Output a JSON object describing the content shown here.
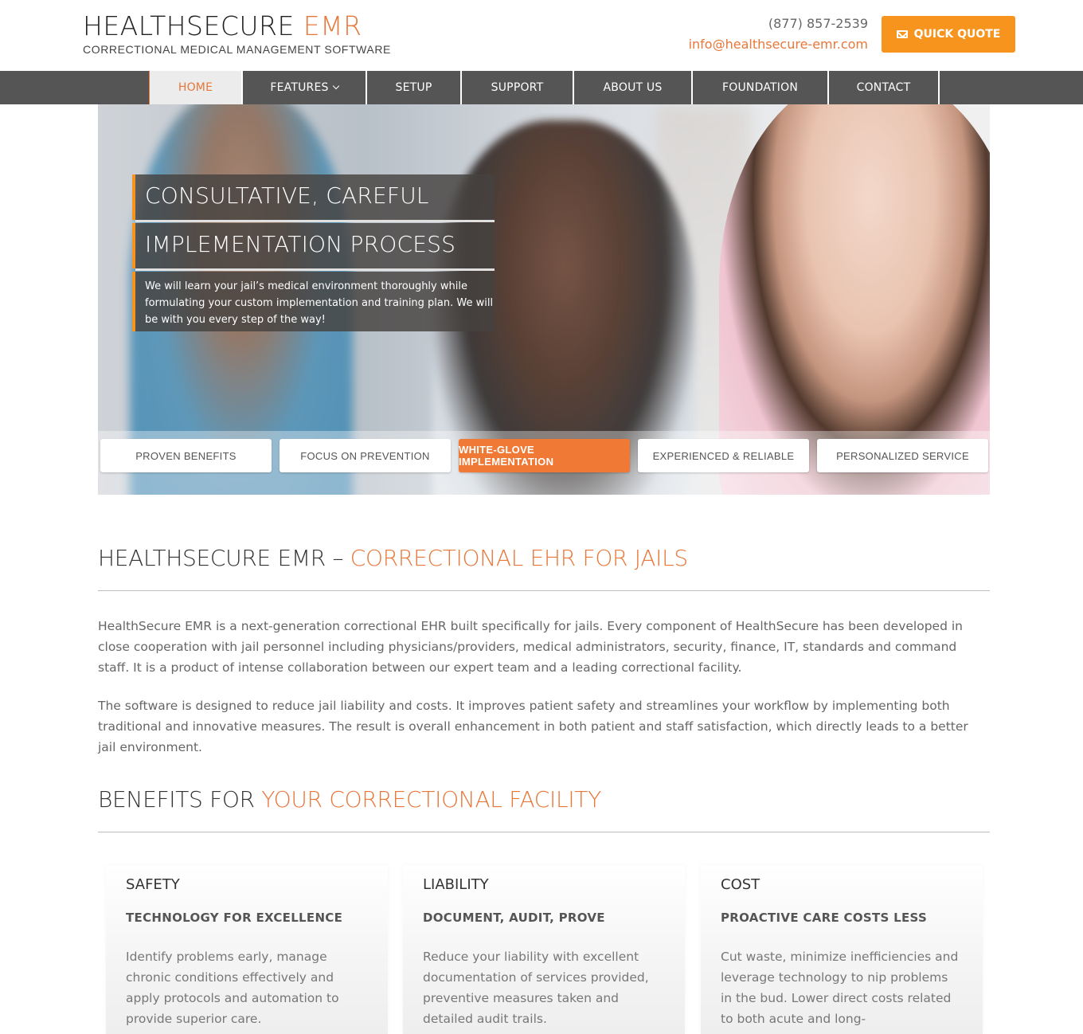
{
  "header": {
    "logo_main": "HEALTHSECURE",
    "logo_accent": "EMR",
    "logo_sub": "CORRECTIONAL MEDICAL MANAGEMENT SOFTWARE",
    "phone": "(877) 857-2539",
    "email": "info@healthsecure-emr.com",
    "quote_label": "QUICK QUOTE",
    "quote_icon": "envelope-icon"
  },
  "nav": {
    "items": [
      {
        "label": "HOME",
        "active": true
      },
      {
        "label": "FEATURES",
        "has_dropdown": true
      },
      {
        "label": "SETUP"
      },
      {
        "label": "SUPPORT"
      },
      {
        "label": "ABOUT US"
      },
      {
        "label": "FOUNDATION"
      },
      {
        "label": "CONTACT"
      }
    ]
  },
  "hero": {
    "caption_line1": "CONSULTATIVE, CAREFUL",
    "caption_line2": "IMPLEMENTATION PROCESS",
    "caption_body": "We will learn your jail’s medical environment thoroughly while formulating your custom implementation and training plan. We will be with you every step of the way!",
    "tabs": [
      {
        "label": "PROVEN BENEFITS"
      },
      {
        "label": "FOCUS ON PREVENTION"
      },
      {
        "label": "WHITE-GLOVE IMPLEMENTATION",
        "active": true
      },
      {
        "label": "EXPERIENCED & RELIABLE"
      },
      {
        "label": "PERSONALIZED SERVICE"
      }
    ]
  },
  "intro": {
    "title_plain": "HEALTHSECURE EMR – ",
    "title_accent": "CORRECTIONAL EHR FOR JAILS",
    "para1": "HealthSecure EMR is a next-generation correctional EHR built specifically for jails. Every component of HealthSecure has been developed in close cooperation with jail personnel including physicians/providers, medical administrators, security, finance, IT, standards and command staff. It is a product of intense collaboration between our expert team and a leading correctional facility.",
    "para2": "The software is designed to reduce jail liability and costs. It improves patient safety and streamlines your workflow by implementing both traditional and innovative measures. The result is overall enhancement in both patient and staff satisfaction, which directly leads to a better jail environment."
  },
  "benefits": {
    "title_plain": "BENEFITS FOR ",
    "title_accent": "YOUR CORRECTIONAL FACILITY",
    "cards": [
      {
        "title": "SAFETY",
        "subtitle": "TECHNOLOGY FOR EXCELLENCE",
        "body": "Identify problems early, manage chronic conditions effectively and apply protocols and automation to provide superior care."
      },
      {
        "title": "LIABILITY",
        "subtitle": "DOCUMENT, AUDIT, PROVE",
        "body": "Reduce your liability with excellent documentation of services provided, preventive measures taken and detailed audit trails."
      },
      {
        "title": "COST",
        "subtitle": "PROACTIVE CARE COSTS LESS",
        "body": "Cut waste, minimize inefficiencies and leverage technology to nip problems in the bud. Lower direct costs related to both acute and long-"
      }
    ]
  },
  "colors": {
    "accent": "#e8773a",
    "button": "#f7941d",
    "nav_bg": "#555555"
  }
}
